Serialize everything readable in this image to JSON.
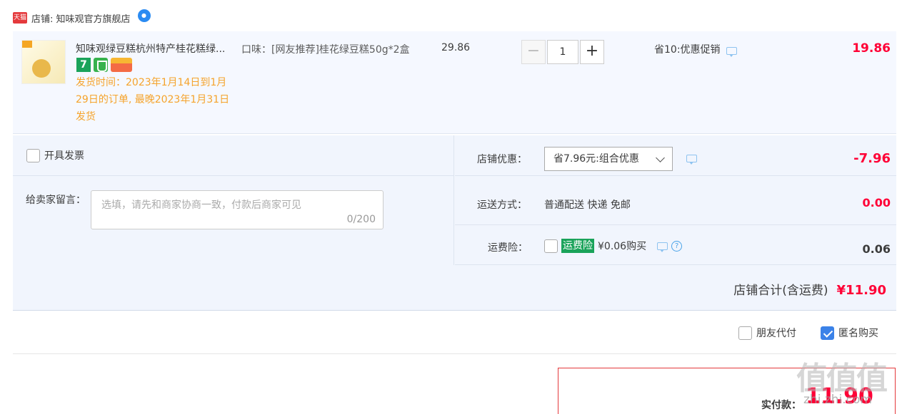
{
  "shop": {
    "badge": "天猫",
    "name": "店铺: 知味观官方旗舰店"
  },
  "item": {
    "title": "知味观绿豆糕杭州特产桂花糕绿...",
    "ship_time": "发货时间：2023年1月14日到1月29日的订单, 最晚2023年1月31日发货",
    "flavor": "口味：[网友推荐]桂花绿豆糕50g*2盒",
    "unit_price": "29.86",
    "quantity": "1",
    "promo": "省10:优惠促销",
    "total": "19.86"
  },
  "options": {
    "invoice_label": "开具发票",
    "message_label": "给卖家留言：",
    "message_placeholder": "选填，请先和商家协商一致，付款后商家可见",
    "message_count": "0/200",
    "discount_label": "店铺优惠：",
    "discount_selected": "省7.96元:组合优惠",
    "discount_value": "-7.96",
    "shipping_label": "运送方式：",
    "shipping_method": "普通配送 快递 免邮",
    "shipping_value": "0.00",
    "insurance_label": "运费险：",
    "insurance_tag": "运费险",
    "insurance_price": "¥0.06购买",
    "insurance_value": "0.06"
  },
  "summary": {
    "shop_total_label": "店铺合计(含运费)",
    "shop_total_value": "¥11.90",
    "friend_pay_label": "朋友代付",
    "anonymous_label": "匿名购买",
    "pay_label": "实付款：",
    "pay_value": "11.90",
    "watermark": "值值值",
    "watermark_sub": "zhi.zhi.com"
  },
  "colors": {
    "accent_red": "#ff0036",
    "tmall_red": "#e4393c",
    "ship_orange": "#f5a32b",
    "insurance_green": "#1aa35a",
    "check_blue": "#3b82e8"
  }
}
